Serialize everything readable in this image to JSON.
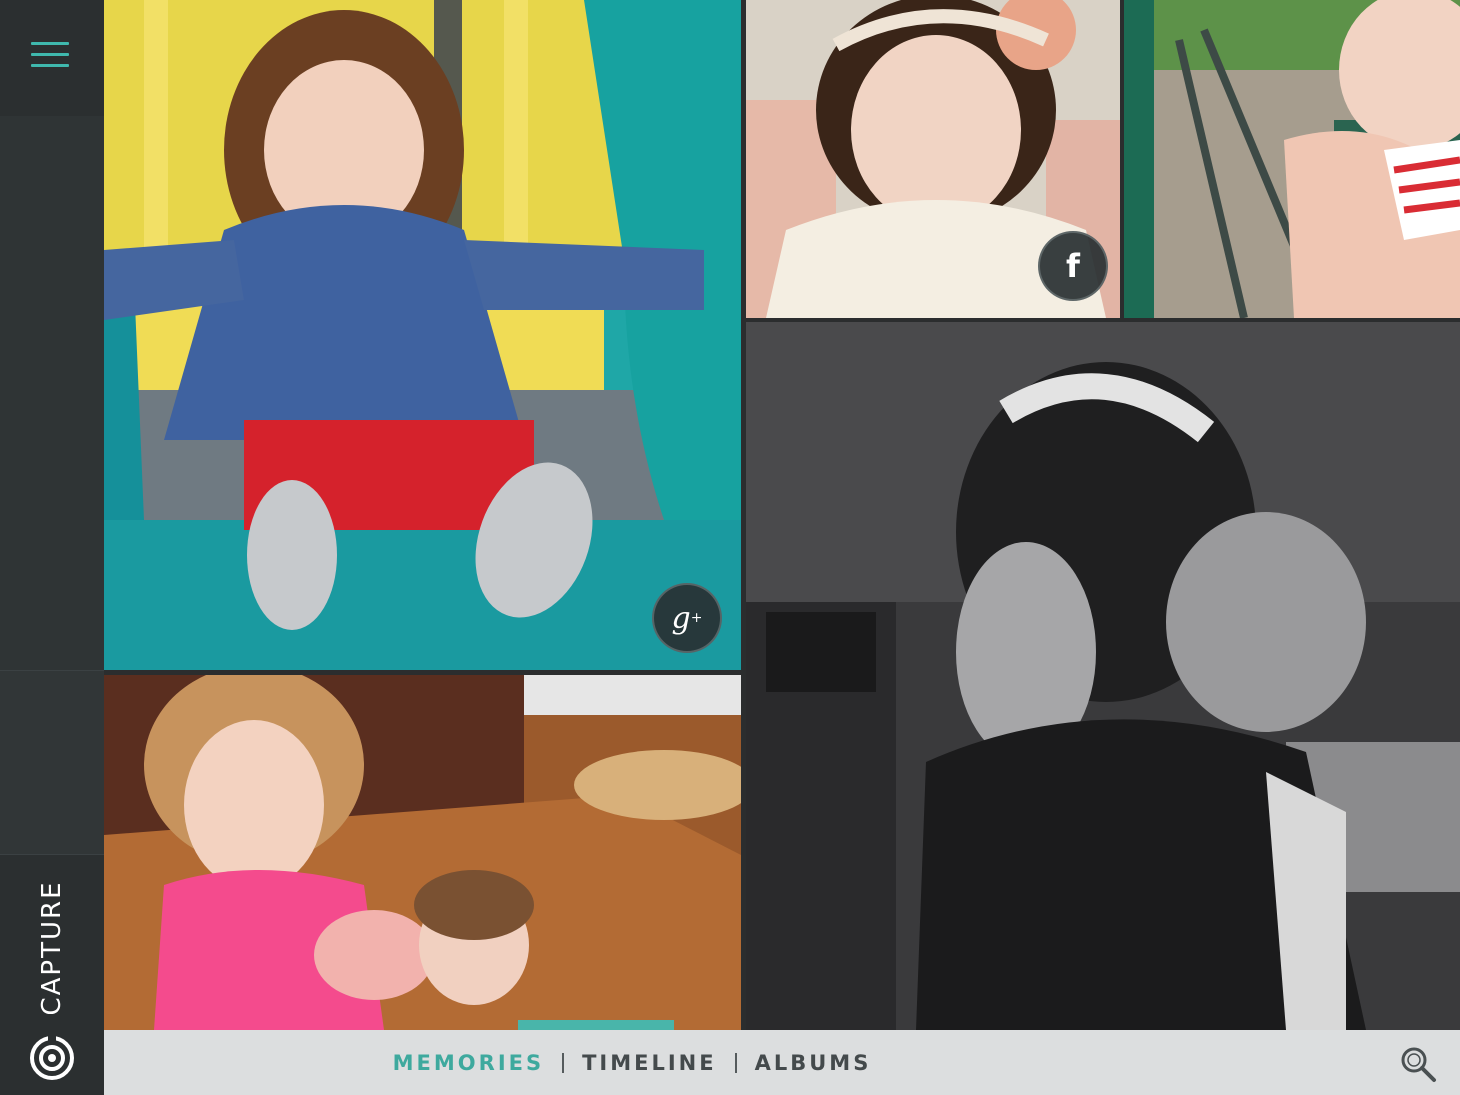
{
  "app": {
    "brand_label": "CAPTURE"
  },
  "nav": {
    "tabs": [
      {
        "label": "MEMORIES",
        "active": true
      },
      {
        "label": "TIMELINE",
        "active": false
      },
      {
        "label": "ALBUMS",
        "active": false
      }
    ]
  },
  "photos": [
    {
      "id": "slide-girl",
      "source_icon": "google-plus-icon"
    },
    {
      "id": "flower-headband-baby",
      "source_icon": "facebook-icon"
    },
    {
      "id": "swing-girl",
      "source_icon": null
    },
    {
      "id": "pigtails-bw",
      "source_icon": null
    },
    {
      "id": "pink-shirt-girls",
      "source_icon": null
    }
  ],
  "badges": {
    "gplus_text": "g",
    "gplus_sup": "+",
    "fb_text": "f"
  },
  "colors": {
    "accent": "#3ea99e",
    "sidebar": "#2e3233",
    "bar": "#eceeef"
  },
  "icons": {
    "menu": "hamburger-menu-icon",
    "search": "search-icon",
    "logo": "capture-logo-icon"
  }
}
